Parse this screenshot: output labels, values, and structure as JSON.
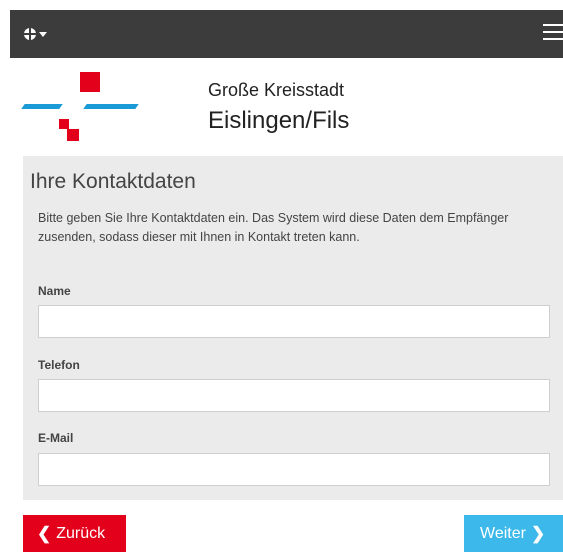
{
  "header": {
    "language_icon": "globe-icon",
    "menu_icon": "hamburger-menu-icon"
  },
  "brand": {
    "line1": "Große Kreisstadt",
    "line2": "Eislingen/Fils",
    "colors": {
      "red": "#e2001a",
      "blue": "#1a9ad6"
    }
  },
  "form": {
    "title": "Ihre Kontaktdaten",
    "description": "Bitte geben Sie Ihre Kontaktdaten ein. Das System wird diese Daten dem Empfänger zusenden, sodass dieser mit Ihnen in Kontakt treten kann.",
    "fields": [
      {
        "label": "Name",
        "value": ""
      },
      {
        "label": "Telefon",
        "value": ""
      },
      {
        "label": "E-Mail",
        "value": ""
      }
    ]
  },
  "nav": {
    "back_label": "Zurück",
    "back_icon": "chevron-left-icon",
    "next_label": "Weiter",
    "next_icon": "chevron-right-icon",
    "back_color": "#e2001a",
    "next_color": "#3cb9ea"
  }
}
